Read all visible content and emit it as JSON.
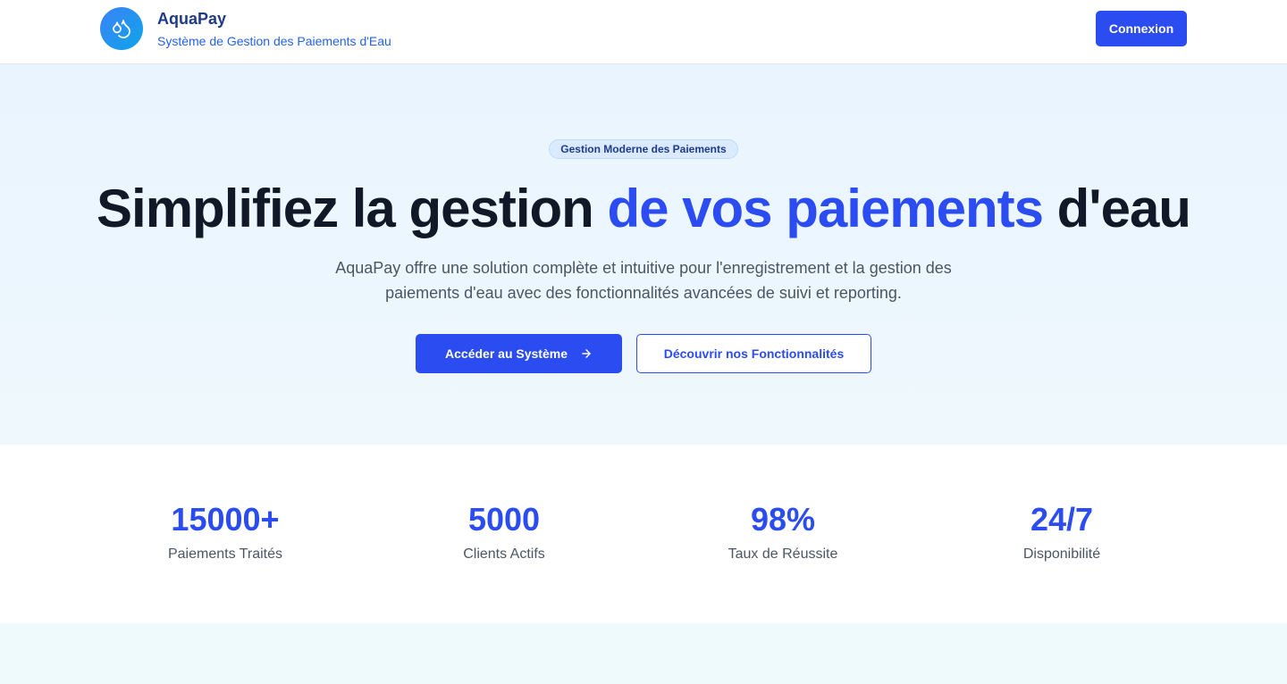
{
  "header": {
    "brand_name": "AquaPay",
    "brand_subtitle": "Système de Gestion des Paiements d'Eau",
    "login_label": "Connexion",
    "logo_icon": "water-drops-icon"
  },
  "hero": {
    "badge": "Gestion Moderne des Paiements",
    "headline_part1": "Simplifiez la gestion ",
    "headline_accent": "de vos paiements",
    "headline_part2": " d'eau",
    "lead_line1": "AquaPay offre une solution complète et intuitive pour l'enregistrement et la gestion des",
    "lead_line2": "paiements d'eau avec des fonctionnalités avancées de suivi et reporting.",
    "primary_cta": "Accéder au Système",
    "primary_cta_icon": "arrow-right-icon",
    "secondary_cta": "Découvrir nos Fonctionnalités"
  },
  "stats": [
    {
      "value": "15000+",
      "label": "Paiements Traités"
    },
    {
      "value": "5000",
      "label": "Clients Actifs"
    },
    {
      "value": "98%",
      "label": "Taux de Réussite"
    },
    {
      "value": "24/7",
      "label": "Disponibilité"
    }
  ],
  "colors": {
    "accent": "#2b4cf0",
    "brand_dark": "#1e3a8a",
    "hero_bg": "#eaf4fe",
    "text_muted": "#4b5563"
  }
}
